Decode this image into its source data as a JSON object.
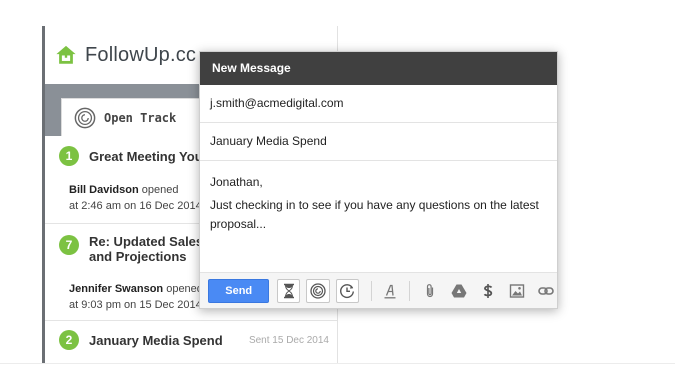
{
  "brand": {
    "name": "FollowUp.cc",
    "icon": "house-arrow-icon",
    "color": "#7cc242"
  },
  "tab": {
    "label": "Open Track",
    "icon": "open-track-icon"
  },
  "items": [
    {
      "badge": "1",
      "title": "Great Meeting You",
      "opener": "Bill Davidson",
      "action": "opened",
      "when": "at 2:46 am on 16 Dec 2014"
    },
    {
      "badge": "7",
      "title_line1": "Re: Updated Sales",
      "title_line2": "and Projections",
      "opener": "Jennifer Swanson",
      "action": "opened",
      "when": "at 9:03 pm on 15 Dec 2014"
    },
    {
      "badge": "2",
      "title": "January Media Spend",
      "sent": "Sent 15 Dec 2014"
    }
  ],
  "compose": {
    "header": "New Message",
    "to": "j.smith@acmedigital.com",
    "subject": "January Media Spend",
    "greeting": "Jonathan,",
    "body": "Just checking in to see if you have any questions on the latest proposal...",
    "send_label": "Send",
    "accent": "#4a8af4"
  },
  "toolbar_icons": [
    "hourglass-icon",
    "open-track-icon",
    "clock-icon",
    "text-format-icon",
    "paperclip-icon",
    "drive-icon",
    "dollar-icon",
    "image-icon",
    "link-icon"
  ]
}
